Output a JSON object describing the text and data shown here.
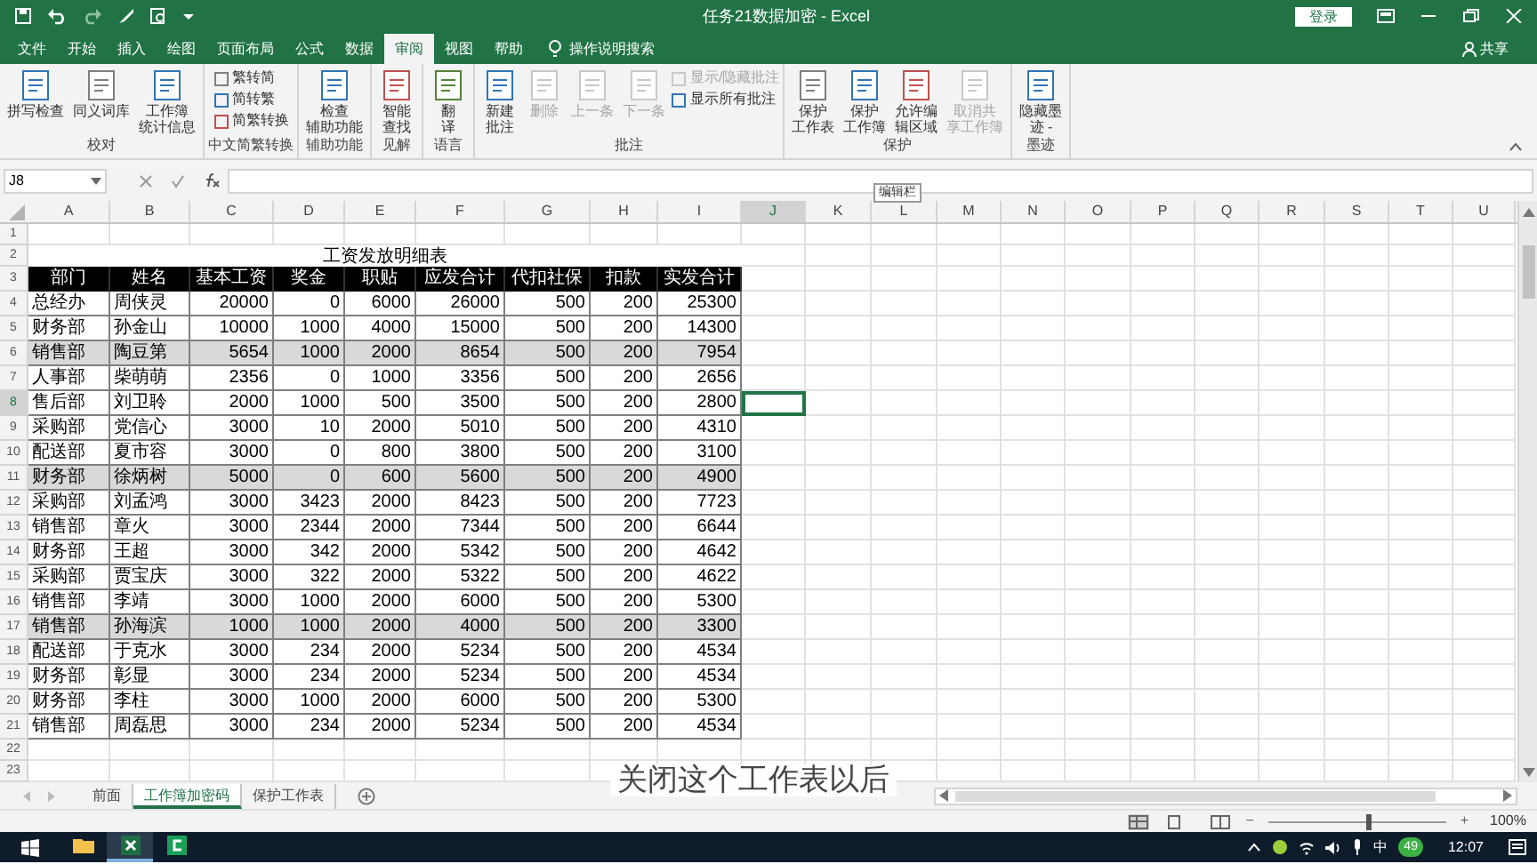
{
  "window": {
    "title": "任务21数据加密 - Excel",
    "signin": "登录",
    "share": "共享"
  },
  "tabs": [
    {
      "label": "文件",
      "selected": false
    },
    {
      "label": "开始",
      "selected": false
    },
    {
      "label": "插入",
      "selected": false
    },
    {
      "label": "绘图",
      "selected": false
    },
    {
      "label": "页面布局",
      "selected": false
    },
    {
      "label": "公式",
      "selected": false
    },
    {
      "label": "数据",
      "selected": false
    },
    {
      "label": "审阅",
      "selected": true
    },
    {
      "label": "视图",
      "selected": false
    },
    {
      "label": "帮助",
      "selected": false
    }
  ],
  "tell_me": "操作说明搜索",
  "ribbon": [
    {
      "label": "校对",
      "buttons": [
        {
          "kind": "large",
          "label": "拼写检查",
          "disabled": false
        },
        {
          "kind": "large",
          "label": "同义词库",
          "disabled": false
        },
        {
          "kind": "large",
          "label": [
            "工作簿",
            "统计信息"
          ],
          "disabled": false
        }
      ]
    },
    {
      "label": "中文简繁转换",
      "buttons": [
        {
          "kind": "small",
          "label": "繁转简",
          "disabled": false
        },
        {
          "kind": "small",
          "label": "简转繁",
          "disabled": false
        },
        {
          "kind": "small",
          "label": "简繁转换",
          "disabled": false
        }
      ]
    },
    {
      "label": "辅助功能",
      "buttons": [
        {
          "kind": "large",
          "label": [
            "检查",
            "辅助功能"
          ],
          "disabled": false
        }
      ]
    },
    {
      "label": "见解",
      "buttons": [
        {
          "kind": "large",
          "label": [
            "智能",
            "查找"
          ],
          "disabled": false
        }
      ]
    },
    {
      "label": "语言",
      "buttons": [
        {
          "kind": "large",
          "label": [
            "翻",
            "译"
          ],
          "disabled": false
        }
      ]
    },
    {
      "label": "批注",
      "buttons": [
        {
          "kind": "large",
          "label": [
            "新建",
            "批注"
          ],
          "disabled": false
        },
        {
          "kind": "large",
          "label": "删除",
          "disabled": true
        },
        {
          "kind": "large",
          "label": "上一条",
          "disabled": true
        },
        {
          "kind": "large",
          "label": "下一条",
          "disabled": true
        },
        {
          "kind": "small",
          "label": "显示/隐藏批注",
          "disabled": true
        },
        {
          "kind": "small",
          "label": "显示所有批注",
          "disabled": false
        }
      ]
    },
    {
      "label": "保护",
      "buttons": [
        {
          "kind": "large",
          "label": [
            "保护",
            "工作表"
          ],
          "disabled": false
        },
        {
          "kind": "large",
          "label": [
            "保护",
            "工作簿"
          ],
          "disabled": false
        },
        {
          "kind": "large",
          "label": [
            "允许编",
            "辑区域"
          ],
          "disabled": false
        },
        {
          "kind": "large",
          "label": [
            "取消共",
            "享工作簿"
          ],
          "disabled": true
        }
      ]
    },
    {
      "label": "墨迹",
      "buttons": [
        {
          "kind": "large",
          "label": [
            "隐藏墨",
            "迹 -"
          ],
          "disabled": false
        }
      ]
    }
  ],
  "name_box": "J8",
  "tooltip": "编辑栏",
  "sheet": {
    "columns": [
      "A",
      "B",
      "C",
      "D",
      "E",
      "F",
      "G",
      "H",
      "I",
      "J",
      "K",
      "L",
      "M",
      "N",
      "O",
      "P",
      "Q",
      "R",
      "S",
      "T",
      "U"
    ],
    "rows": [
      {
        "num": "1",
        "kind": "empty"
      },
      {
        "num": "2",
        "kind": "title",
        "title": "工资发放明细表"
      },
      {
        "num": "3",
        "kind": "header",
        "cells": [
          "部门",
          "姓名",
          "基本工资",
          "奖金",
          "职贴",
          "应发合计",
          "代扣社保",
          "扣款",
          "实发合计"
        ]
      },
      {
        "num": "4",
        "kind": "data",
        "highlighted": false,
        "cells": [
          "总经办",
          "周侠灵",
          "20000",
          "0",
          "6000",
          "26000",
          "500",
          "200",
          "25300"
        ]
      },
      {
        "num": "5",
        "kind": "data",
        "highlighted": false,
        "cells": [
          "财务部",
          "孙金山",
          "10000",
          "1000",
          "4000",
          "15000",
          "500",
          "200",
          "14300"
        ]
      },
      {
        "num": "6",
        "kind": "data",
        "highlighted": true,
        "cells": [
          "销售部",
          "陶豆第",
          "5654",
          "1000",
          "2000",
          "8654",
          "500",
          "200",
          "7954"
        ]
      },
      {
        "num": "7",
        "kind": "data",
        "highlighted": false,
        "cells": [
          "人事部",
          "柴萌萌",
          "2356",
          "0",
          "1000",
          "3356",
          "500",
          "200",
          "2656"
        ]
      },
      {
        "num": "8",
        "kind": "data",
        "highlighted": false,
        "cells": [
          "售后部",
          "刘卫聆",
          "2000",
          "1000",
          "500",
          "3500",
          "500",
          "200",
          "2800"
        ]
      },
      {
        "num": "9",
        "kind": "data",
        "highlighted": false,
        "cells": [
          "采购部",
          "党信心",
          "3000",
          "10",
          "2000",
          "5010",
          "500",
          "200",
          "4310"
        ]
      },
      {
        "num": "10",
        "kind": "data",
        "highlighted": false,
        "cells": [
          "配送部",
          "夏市容",
          "3000",
          "0",
          "800",
          "3800",
          "500",
          "200",
          "3100"
        ]
      },
      {
        "num": "11",
        "kind": "data",
        "highlighted": true,
        "cells": [
          "财务部",
          "徐炳树",
          "5000",
          "0",
          "600",
          "5600",
          "500",
          "200",
          "4900"
        ]
      },
      {
        "num": "12",
        "kind": "data",
        "highlighted": false,
        "cells": [
          "采购部",
          "刘孟鸿",
          "3000",
          "3423",
          "2000",
          "8423",
          "500",
          "200",
          "7723"
        ]
      },
      {
        "num": "13",
        "kind": "data",
        "highlighted": false,
        "cells": [
          "销售部",
          "章火",
          "3000",
          "2344",
          "2000",
          "7344",
          "500",
          "200",
          "6644"
        ]
      },
      {
        "num": "14",
        "kind": "data",
        "highlighted": false,
        "cells": [
          "财务部",
          "王超",
          "3000",
          "342",
          "2000",
          "5342",
          "500",
          "200",
          "4642"
        ]
      },
      {
        "num": "15",
        "kind": "data",
        "highlighted": false,
        "cells": [
          "采购部",
          "贾宝庆",
          "3000",
          "322",
          "2000",
          "5322",
          "500",
          "200",
          "4622"
        ]
      },
      {
        "num": "16",
        "kind": "data",
        "highlighted": false,
        "cells": [
          "销售部",
          "李靖",
          "3000",
          "1000",
          "2000",
          "6000",
          "500",
          "200",
          "5300"
        ]
      },
      {
        "num": "17",
        "kind": "data",
        "highlighted": true,
        "cells": [
          "销售部",
          "孙海滨",
          "1000",
          "1000",
          "2000",
          "4000",
          "500",
          "200",
          "3300"
        ]
      },
      {
        "num": "18",
        "kind": "data",
        "highlighted": false,
        "cells": [
          "配送部",
          "于克水",
          "3000",
          "234",
          "2000",
          "5234",
          "500",
          "200",
          "4534"
        ]
      },
      {
        "num": "19",
        "kind": "data",
        "highlighted": false,
        "cells": [
          "财务部",
          "彰显",
          "3000",
          "234",
          "2000",
          "5234",
          "500",
          "200",
          "4534"
        ]
      },
      {
        "num": "20",
        "kind": "data",
        "highlighted": false,
        "cells": [
          "财务部",
          "李柱",
          "3000",
          "1000",
          "2000",
          "6000",
          "500",
          "200",
          "5300"
        ]
      },
      {
        "num": "21",
        "kind": "data",
        "highlighted": false,
        "cells": [
          "销售部",
          "周磊思",
          "3000",
          "234",
          "2000",
          "5234",
          "500",
          "200",
          "4534"
        ]
      },
      {
        "num": "22",
        "kind": "empty"
      },
      {
        "num": "23",
        "kind": "empty"
      }
    ]
  },
  "sheet_tabs": [
    {
      "label": "前面",
      "selected": false
    },
    {
      "label": "工作簿加密码",
      "selected": true
    },
    {
      "label": "保护工作表",
      "selected": false
    }
  ],
  "subtitle": "关闭这个工作表以后",
  "status_bar": {
    "zoom_out": "−",
    "zoom": {
      "level": 0.55
    },
    "zoom_in": "+",
    "zoom_text": "100%"
  },
  "taskbar": {
    "apps": [
      {
        "kind": "folder",
        "active": false
      },
      {
        "kind": "excel",
        "active": true
      },
      {
        "kind": "app",
        "active": false
      }
    ],
    "ime": "中",
    "badge": "49",
    "time": "12:07"
  }
}
